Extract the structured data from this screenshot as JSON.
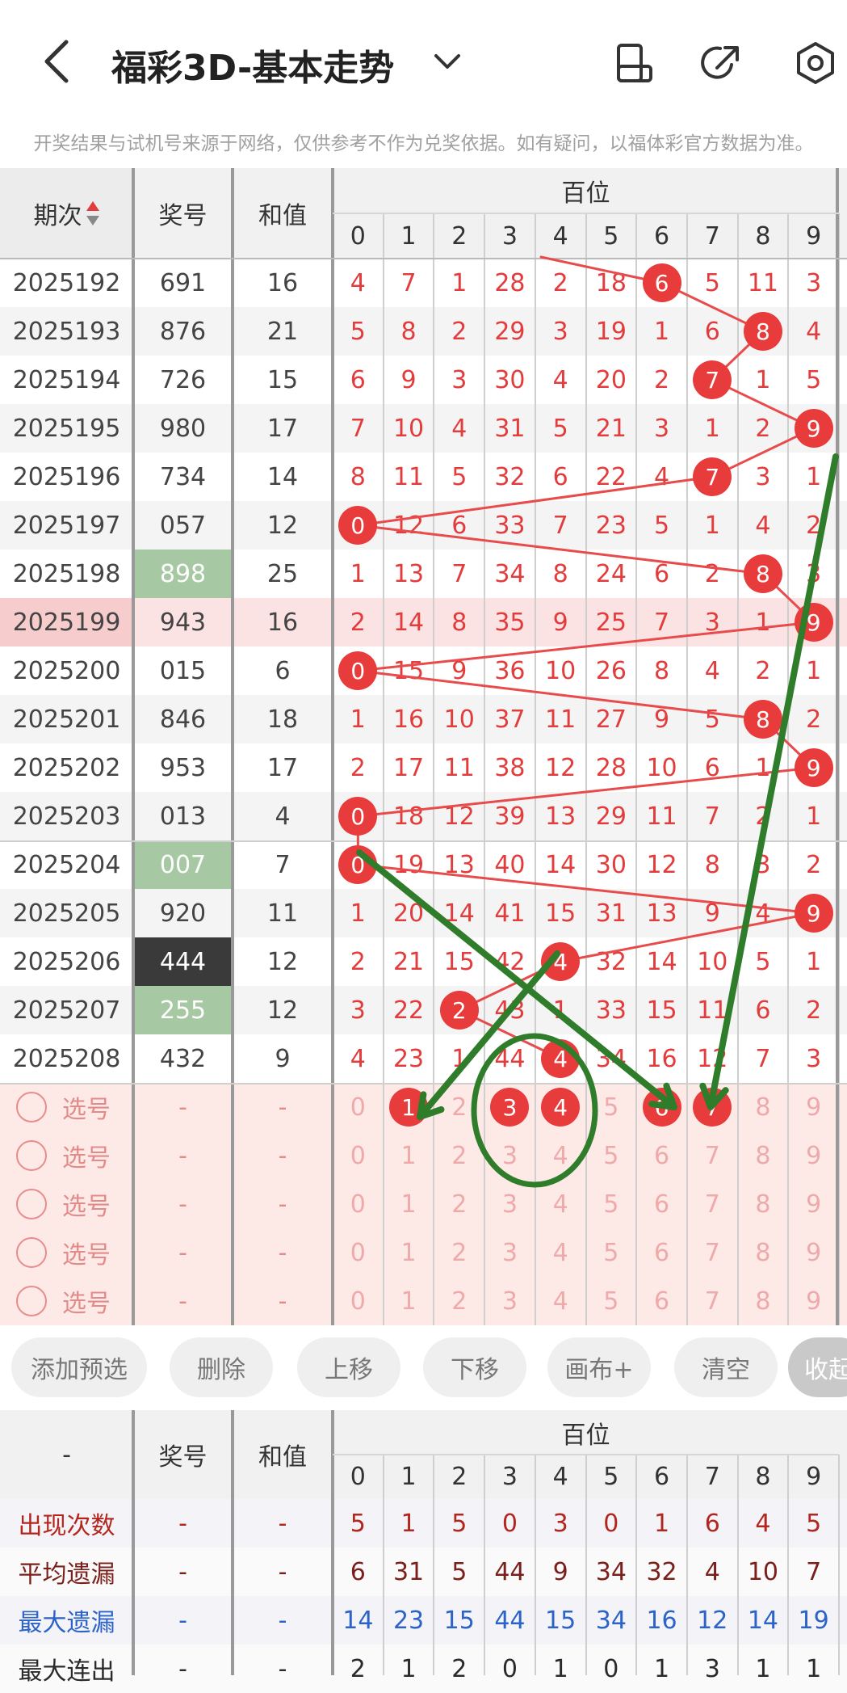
{
  "header": {
    "title": "福彩3D-基本走势",
    "notice": "开奖结果与试机号来源于网络，仅供参考不作为兑奖依据。如有疑问，以福体彩官方数据为准。"
  },
  "table": {
    "col_period": "期次",
    "col_number": "奖号",
    "col_sum": "和值",
    "group_label": "百位",
    "digits": [
      "0",
      "1",
      "2",
      "3",
      "4",
      "5",
      "6",
      "7",
      "8",
      "9"
    ],
    "rows": [
      {
        "period": "2025192",
        "number": "691",
        "sum": "16",
        "cells": [
          "4",
          "7",
          "1",
          "28",
          "2",
          "18",
          "6",
          "5",
          "11",
          "3"
        ],
        "hit": 6
      },
      {
        "period": "2025193",
        "number": "876",
        "sum": "21",
        "cells": [
          "5",
          "8",
          "2",
          "29",
          "3",
          "19",
          "1",
          "6",
          "8",
          "4"
        ],
        "hit": 8
      },
      {
        "period": "2025194",
        "number": "726",
        "sum": "15",
        "cells": [
          "6",
          "9",
          "3",
          "30",
          "4",
          "20",
          "2",
          "7",
          "1",
          "5"
        ],
        "hit": 7
      },
      {
        "period": "2025195",
        "number": "980",
        "sum": "17",
        "cells": [
          "7",
          "10",
          "4",
          "31",
          "5",
          "21",
          "3",
          "1",
          "2",
          "9"
        ],
        "hit": 9
      },
      {
        "period": "2025196",
        "number": "734",
        "sum": "14",
        "cells": [
          "8",
          "11",
          "5",
          "32",
          "6",
          "22",
          "4",
          "7",
          "3",
          "1"
        ],
        "hit": 7
      },
      {
        "period": "2025197",
        "number": "057",
        "sum": "12",
        "cells": [
          "0",
          "12",
          "6",
          "33",
          "7",
          "23",
          "5",
          "1",
          "4",
          "2"
        ],
        "hit": 0
      },
      {
        "period": "2025198",
        "number": "898",
        "sum": "25",
        "cells": [
          "1",
          "13",
          "7",
          "34",
          "8",
          "24",
          "6",
          "2",
          "8",
          "3"
        ],
        "hit": 8,
        "numStyle": "green"
      },
      {
        "period": "2025199",
        "number": "943",
        "sum": "16",
        "cells": [
          "2",
          "14",
          "8",
          "35",
          "9",
          "25",
          "7",
          "3",
          "1",
          "9"
        ],
        "hit": 9,
        "highlight": true
      },
      {
        "period": "2025200",
        "number": "015",
        "sum": "6",
        "cells": [
          "0",
          "15",
          "9",
          "36",
          "10",
          "26",
          "8",
          "4",
          "2",
          "1"
        ],
        "hit": 0
      },
      {
        "period": "2025201",
        "number": "846",
        "sum": "18",
        "cells": [
          "1",
          "16",
          "10",
          "37",
          "11",
          "27",
          "9",
          "5",
          "8",
          "2"
        ],
        "hit": 8
      },
      {
        "period": "2025202",
        "number": "953",
        "sum": "17",
        "cells": [
          "2",
          "17",
          "11",
          "38",
          "12",
          "28",
          "10",
          "6",
          "1",
          "9"
        ],
        "hit": 9
      },
      {
        "period": "2025203",
        "number": "013",
        "sum": "4",
        "cells": [
          "0",
          "18",
          "12",
          "39",
          "13",
          "29",
          "11",
          "7",
          "2",
          "1"
        ],
        "hit": 0
      },
      {
        "period": "2025204",
        "number": "007",
        "sum": "7",
        "cells": [
          "0",
          "19",
          "13",
          "40",
          "14",
          "30",
          "12",
          "8",
          "3",
          "2"
        ],
        "hit": 0,
        "numStyle": "green"
      },
      {
        "period": "2025205",
        "number": "920",
        "sum": "11",
        "cells": [
          "1",
          "20",
          "14",
          "41",
          "15",
          "31",
          "13",
          "9",
          "4",
          "9"
        ],
        "hit": 9
      },
      {
        "period": "2025206",
        "number": "444",
        "sum": "12",
        "cells": [
          "2",
          "21",
          "15",
          "42",
          "4",
          "32",
          "14",
          "10",
          "5",
          "1"
        ],
        "hit": 4,
        "numStyle": "dark"
      },
      {
        "period": "2025207",
        "number": "255",
        "sum": "12",
        "cells": [
          "3",
          "22",
          "2",
          "43",
          "1",
          "33",
          "15",
          "11",
          "6",
          "2"
        ],
        "hit": 2,
        "numStyle": "green"
      },
      {
        "period": "2025208",
        "number": "432",
        "sum": "9",
        "cells": [
          "4",
          "23",
          "1",
          "44",
          "4",
          "34",
          "16",
          "12",
          "7",
          "3"
        ],
        "hit": 4
      }
    ],
    "pick_rows": [
      {
        "label": "选号",
        "dash1": "-",
        "dash2": "-",
        "digits": [
          "0",
          "1",
          "2",
          "3",
          "4",
          "5",
          "6",
          "7",
          "8",
          "9"
        ],
        "selected": [
          1,
          3,
          4,
          6,
          7
        ]
      },
      {
        "label": "选号",
        "dash1": "-",
        "dash2": "-",
        "digits": [
          "0",
          "1",
          "2",
          "3",
          "4",
          "5",
          "6",
          "7",
          "8",
          "9"
        ],
        "selected": []
      },
      {
        "label": "选号",
        "dash1": "-",
        "dash2": "-",
        "digits": [
          "0",
          "1",
          "2",
          "3",
          "4",
          "5",
          "6",
          "7",
          "8",
          "9"
        ],
        "selected": []
      },
      {
        "label": "选号",
        "dash1": "-",
        "dash2": "-",
        "digits": [
          "0",
          "1",
          "2",
          "3",
          "4",
          "5",
          "6",
          "7",
          "8",
          "9"
        ],
        "selected": []
      },
      {
        "label": "选号",
        "dash1": "-",
        "dash2": "-",
        "digits": [
          "0",
          "1",
          "2",
          "3",
          "4",
          "5",
          "6",
          "7",
          "8",
          "9"
        ],
        "selected": []
      }
    ]
  },
  "toolbar": [
    "添加预选",
    "删除",
    "上移",
    "下移",
    "画布+",
    "清空",
    "收起"
  ],
  "stats": {
    "col_dash": "-",
    "col_number": "奖号",
    "col_sum": "和值",
    "group_label": "百位",
    "digits": [
      "0",
      "1",
      "2",
      "3",
      "4",
      "5",
      "6",
      "7",
      "8",
      "9"
    ],
    "rows": [
      {
        "label": "出现次数",
        "dash1": "-",
        "dash2": "-",
        "values": [
          "5",
          "1",
          "5",
          "0",
          "3",
          "0",
          "1",
          "6",
          "4",
          "5"
        ],
        "color": "#b3261e"
      },
      {
        "label": "平均遗漏",
        "dash1": "-",
        "dash2": "-",
        "values": [
          "6",
          "31",
          "5",
          "44",
          "9",
          "34",
          "32",
          "4",
          "10",
          "7"
        ],
        "color": "#7a1f1a"
      },
      {
        "label": "最大遗漏",
        "dash1": "-",
        "dash2": "-",
        "values": [
          "14",
          "23",
          "15",
          "44",
          "15",
          "34",
          "16",
          "12",
          "14",
          "19"
        ],
        "color": "#2c63c8"
      },
      {
        "label": "最大连出",
        "dash1": "-",
        "dash2": "-",
        "values": [
          "2",
          "1",
          "2",
          "0",
          "1",
          "0",
          "1",
          "3",
          "1",
          "1"
        ],
        "color": "#2a2a2a"
      }
    ]
  },
  "colors": {
    "hit_ball": "#e83b3b",
    "green_num": "#a6c8a2",
    "dark_num": "#3a3a3a",
    "annotation_green": "#2f7d2a"
  }
}
